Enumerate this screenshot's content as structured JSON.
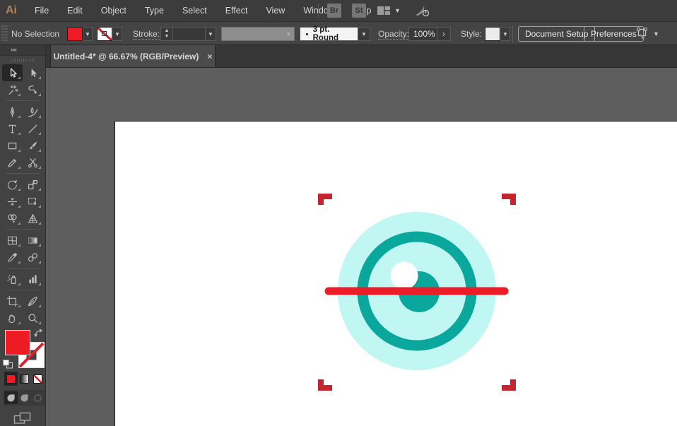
{
  "colors": {
    "fill_red": "#ed1c24",
    "none_slash_red": "#d8232a"
  },
  "menubar": {
    "logo": "Ai",
    "items": [
      "File",
      "Edit",
      "Object",
      "Type",
      "Select",
      "Effect",
      "View",
      "Window",
      "Help"
    ],
    "bridge_label": "Br",
    "stock_label": "St"
  },
  "controlbar": {
    "selection_status": "No Selection",
    "stroke_label": "Stroke:",
    "brush_value": "3 pt. Round",
    "opacity_label": "Opacity:",
    "opacity_value": "100%",
    "style_label": "Style:",
    "document_setup_label": "Document Setup",
    "preferences_label": "Preferences"
  },
  "tabbar": {
    "title": "Untitled-4* @ 66.67% (RGB/Preview)",
    "close_glyph": "×"
  },
  "toolbar": {
    "collapse_glyph": "««",
    "active_tool": "selection",
    "groups": [
      [
        "selection",
        "direct-selection",
        "magic-wand",
        "lasso"
      ],
      [
        "pen",
        "curvature",
        "type",
        "line-segment",
        "rectangle",
        "paintbrush",
        "pencil",
        "scissors"
      ],
      [
        "rotate",
        "scale",
        "width",
        "free-transform",
        "shape-builder",
        "perspective-grid"
      ],
      [
        "mesh",
        "gradient",
        "eyedropper",
        "blend"
      ],
      [
        "symbol-sprayer",
        "column-graph"
      ],
      [
        "artboard",
        "slice",
        "hand",
        "zoom"
      ]
    ]
  },
  "artwork": {
    "colors": {
      "body": "#c0f7f3",
      "iris": "#0aa79c",
      "highlight": "#ffffff",
      "scan_line": "#ec1c28",
      "frame": "#c3262e"
    }
  }
}
